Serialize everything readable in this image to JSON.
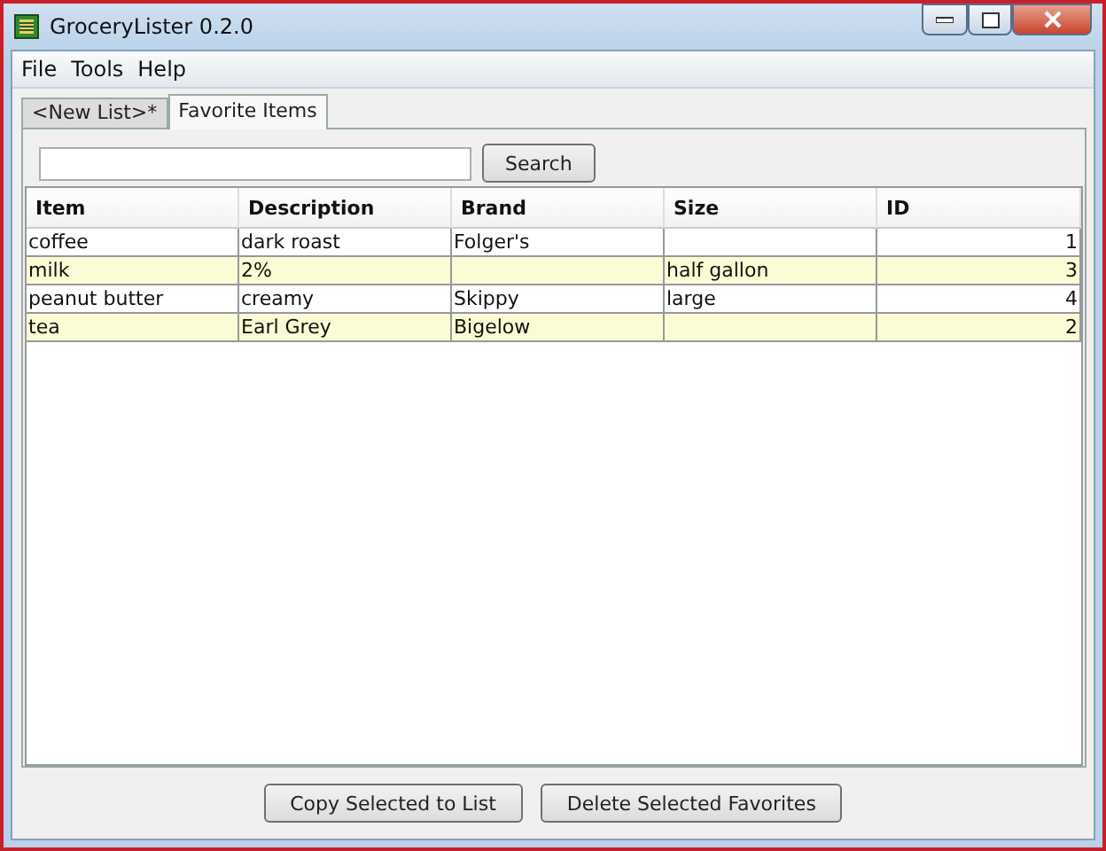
{
  "window": {
    "title": "GroceryLister 0.2.0"
  },
  "menu": [
    "File",
    "Tools",
    "Help"
  ],
  "tabs": [
    {
      "label": "<New List>*",
      "selected": false
    },
    {
      "label": "Favorite Items",
      "selected": true
    }
  ],
  "search": {
    "button": "Search"
  },
  "table": {
    "columns": [
      {
        "label": "Item",
        "kind": "text"
      },
      {
        "label": "Description",
        "kind": "text"
      },
      {
        "label": "Brand",
        "kind": "text"
      },
      {
        "label": "Size",
        "kind": "text"
      },
      {
        "label": "ID",
        "kind": "number"
      }
    ],
    "rows": [
      [
        "coffee",
        "dark roast",
        "Folger's",
        "",
        "1"
      ],
      [
        "milk",
        "2%",
        "",
        "half gallon",
        "3"
      ],
      [
        "peanut butter",
        "creamy",
        "Skippy",
        "large",
        "4"
      ],
      [
        "tea",
        "Earl Grey",
        "Bigelow",
        "",
        "2"
      ]
    ]
  },
  "buttons": [
    "Copy Selected to List",
    "Delete Selected Favorites"
  ]
}
